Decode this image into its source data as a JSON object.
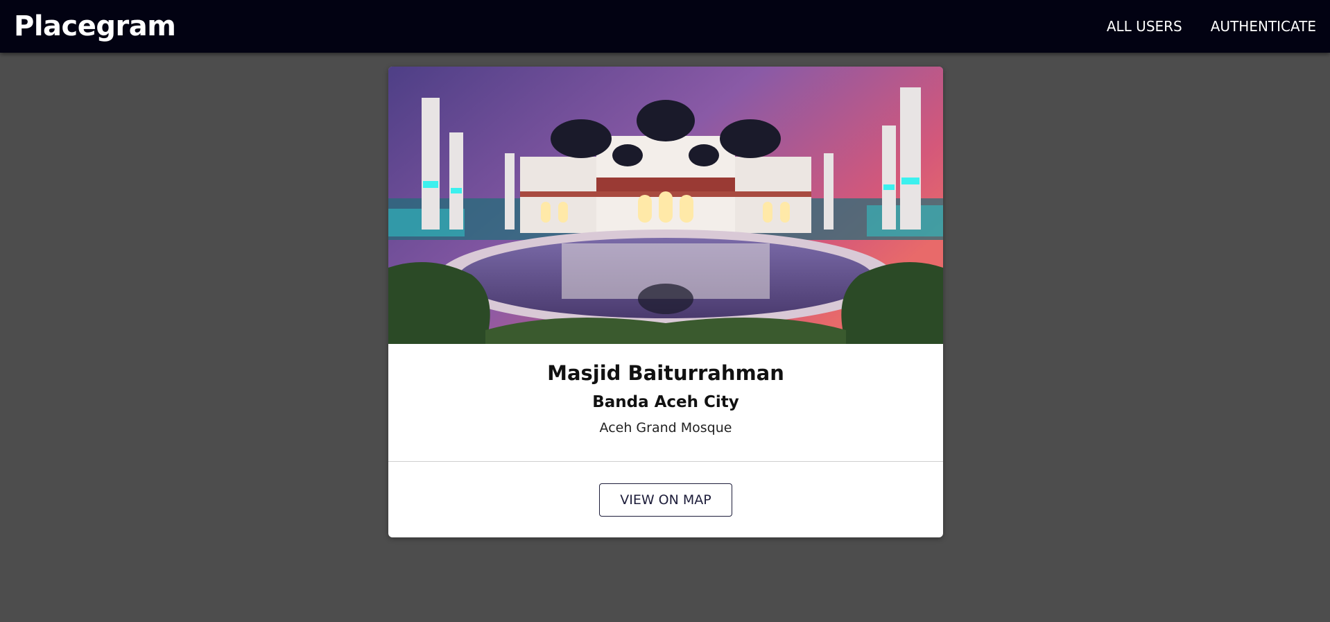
{
  "header": {
    "logo": "Placegram",
    "nav": [
      {
        "label": "ALL USERS"
      },
      {
        "label": "AUTHENTICATE"
      }
    ]
  },
  "place": {
    "title": "Masjid Baiturrahman",
    "address": "Banda Aceh City",
    "description": "Aceh Grand Mosque",
    "image_subject": "illuminated mosque with domes and minarets reflected in a pool at dusk",
    "view_on_map_label": "VIEW ON MAP"
  },
  "colors": {
    "navbar": "#020212",
    "page_background": "#4d4d4d",
    "card": "#ffffff",
    "button_border": "#1d1d3a"
  }
}
